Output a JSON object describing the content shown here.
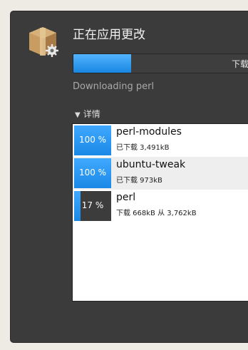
{
  "dialog": {
    "title": "正在应用更改",
    "progress": {
      "percent": 31,
      "text": "下载"
    },
    "status": "Downloading perl",
    "details_label": "详情",
    "items": [
      {
        "percent": 100,
        "percent_label": "100 %",
        "name": "perl-modules",
        "subtitle": "已下载 3,491kB"
      },
      {
        "percent": 100,
        "percent_label": "100 %",
        "name": "ubuntu-tweak",
        "subtitle": "已下载 973kB"
      },
      {
        "percent": 17,
        "percent_label": "17 %",
        "name": "perl",
        "subtitle": "下载 668kB 从 3,762kB"
      }
    ]
  },
  "icons": {
    "app": "package-settings-icon",
    "expander": "triangle-down-icon"
  },
  "colors": {
    "accent": "#1a88e6",
    "window_bg": "#3b3b3b"
  }
}
